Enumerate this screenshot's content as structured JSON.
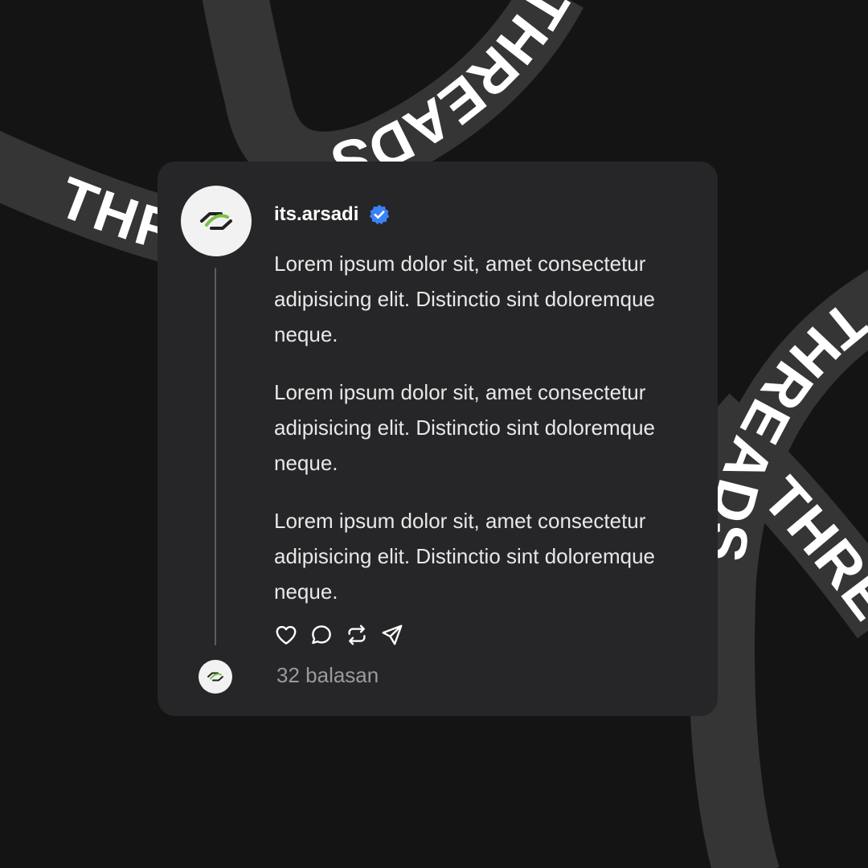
{
  "background": {
    "ribbon_text": "THREADS",
    "ribbon_color": "#353535",
    "page_color": "#141414"
  },
  "post": {
    "username": "its.arsadi",
    "verified_badge": "verified-badge-icon",
    "badge_color": "#3b82f6",
    "avatar": "threads-logo-avatar",
    "paragraphs": [
      "Lorem ipsum dolor sit, amet consectetur adipisicing elit. Distinctio sint doloremque neque.",
      "Lorem ipsum dolor sit, amet consectetur adipisicing elit. Distinctio sint doloremque neque.",
      "Lorem ipsum dolor sit, amet consectetur adipisicing elit. Distinctio sint doloremque neque."
    ],
    "actions": [
      "heart-icon",
      "comment-icon",
      "repost-icon",
      "send-icon"
    ],
    "replies_label": "32 balasan"
  }
}
